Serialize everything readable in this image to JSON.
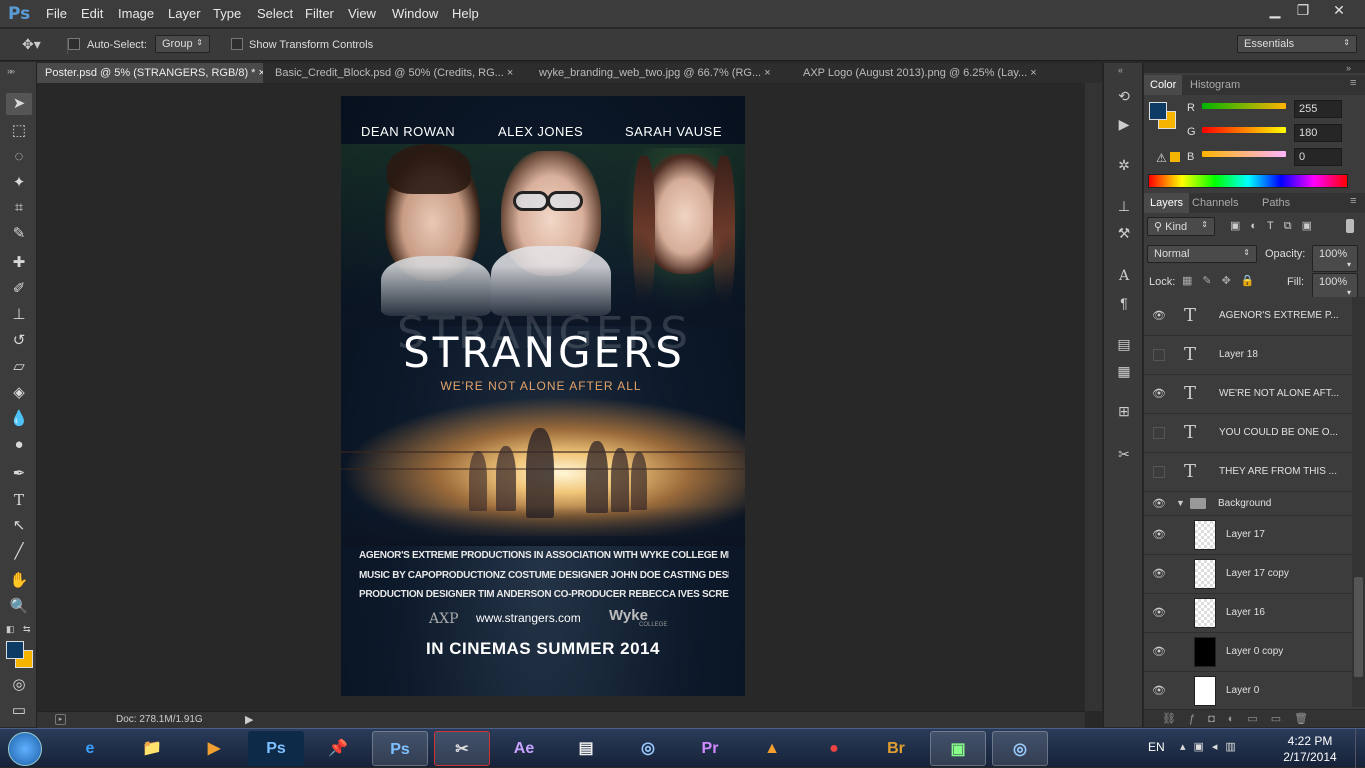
{
  "app": {
    "logo": "Ps"
  },
  "menu": [
    "File",
    "Edit",
    "Image",
    "Layer",
    "Type",
    "Select",
    "Filter",
    "View",
    "Window",
    "Help"
  ],
  "window_controls": {
    "minimize": "▁",
    "restore": "❐",
    "close": "✕"
  },
  "options": {
    "auto_select_label": "Auto-Select:",
    "auto_select_value": "Group",
    "transform_label": "Show Transform Controls",
    "workspace": "Essentials"
  },
  "tabs": [
    {
      "label": "Poster.psd @ 5% (STRANGERS, RGB/8) *",
      "close": "×"
    },
    {
      "label": "Basic_Credit_Block.psd @ 50% (Credits, RG...",
      "close": "×"
    },
    {
      "label": "wyke_branding_web_two.jpg @ 66.7% (RG...",
      "close": "×"
    },
    {
      "label": "AXP Logo (August 2013).png @ 6.25% (Lay...",
      "close": "×"
    }
  ],
  "poster": {
    "actors": [
      "DEAN ROWAN",
      "ALEX JONES",
      "SARAH VAUSE"
    ],
    "title": "STRANGERS",
    "tagline": "WE'RE NOT ALONE AFTER ALL",
    "credits": [
      "AGENOR'S EXTREME PRODUCTIONS IN ASSOCIATION WITH WYKE COLLEGE MEDIA PRESENTS A JEFF AGENOR FILM",
      "MUSIC BY CAPOPRODUCTIONZ COSTUME DESIGNER JOHN DOE CASTING DESIGNER ANGENA AGENOR DIRECTOR OF PHOTOGRAPHY JEFF AGENOR",
      "PRODUCTION DESIGNER TIM ANDERSON CO-PRODUCER REBECCA IVES SCREENPLAY BY JEFF AGENOR CO-DIRECTOR DEAN ROWAN DIRECTED BY JEFF AGENOR"
    ],
    "website": "www.strangers.com",
    "logo_axp": "AXP",
    "logo_wyke": "Wyke",
    "logo_wyke_sub": "COLLEGE",
    "release": "IN CINEMAS SUMMER 2014"
  },
  "status": {
    "doc": "Doc: 278.1M/1.91G"
  },
  "color_panel": {
    "tabs": [
      "Color",
      "Histogram"
    ],
    "labels": [
      "R",
      "G",
      "B"
    ],
    "values": [
      "255",
      "180",
      "0"
    ],
    "colors": {
      "foreground": "#0d3b66",
      "background": "#f5b400"
    }
  },
  "layers_panel": {
    "tabs": [
      "Layers",
      "Channels",
      "Paths"
    ],
    "filter": "Kind",
    "blend": "Normal",
    "opacity_label": "Opacity:",
    "opacity": "100%",
    "lock_label": "Lock:",
    "fill_label": "Fill:",
    "fill": "100%",
    "layers": [
      {
        "name": "AGENOR'S EXTREME P...",
        "visible": true,
        "type": "text"
      },
      {
        "name": "Layer 18",
        "visible": false,
        "type": "text"
      },
      {
        "name": "WE'RE NOT ALONE AFT...",
        "visible": true,
        "type": "text"
      },
      {
        "name": "YOU COULD BE ONE O...",
        "visible": false,
        "type": "text"
      },
      {
        "name": "THEY ARE FROM THIS ...",
        "visible": false,
        "type": "text"
      }
    ],
    "group": "Background",
    "group_layers": [
      {
        "name": "Layer 17",
        "thumb": "transparent"
      },
      {
        "name": "Layer 17 copy",
        "thumb": "transparent"
      },
      {
        "name": "Layer 16",
        "thumb": "transparent"
      },
      {
        "name": "Layer 0 copy",
        "thumb": "black"
      },
      {
        "name": "Layer 0",
        "thumb": "white"
      }
    ]
  },
  "taskbar": {
    "apps": [
      "e",
      "📁",
      "▶",
      "Ps",
      "📌",
      "Ps",
      "✂",
      "Ae",
      "▤",
      "◎",
      "Pr",
      "▲",
      "●",
      "Br",
      "▣",
      "◎"
    ],
    "lang": "EN",
    "time": "4:22 PM",
    "date": "2/17/2014"
  }
}
